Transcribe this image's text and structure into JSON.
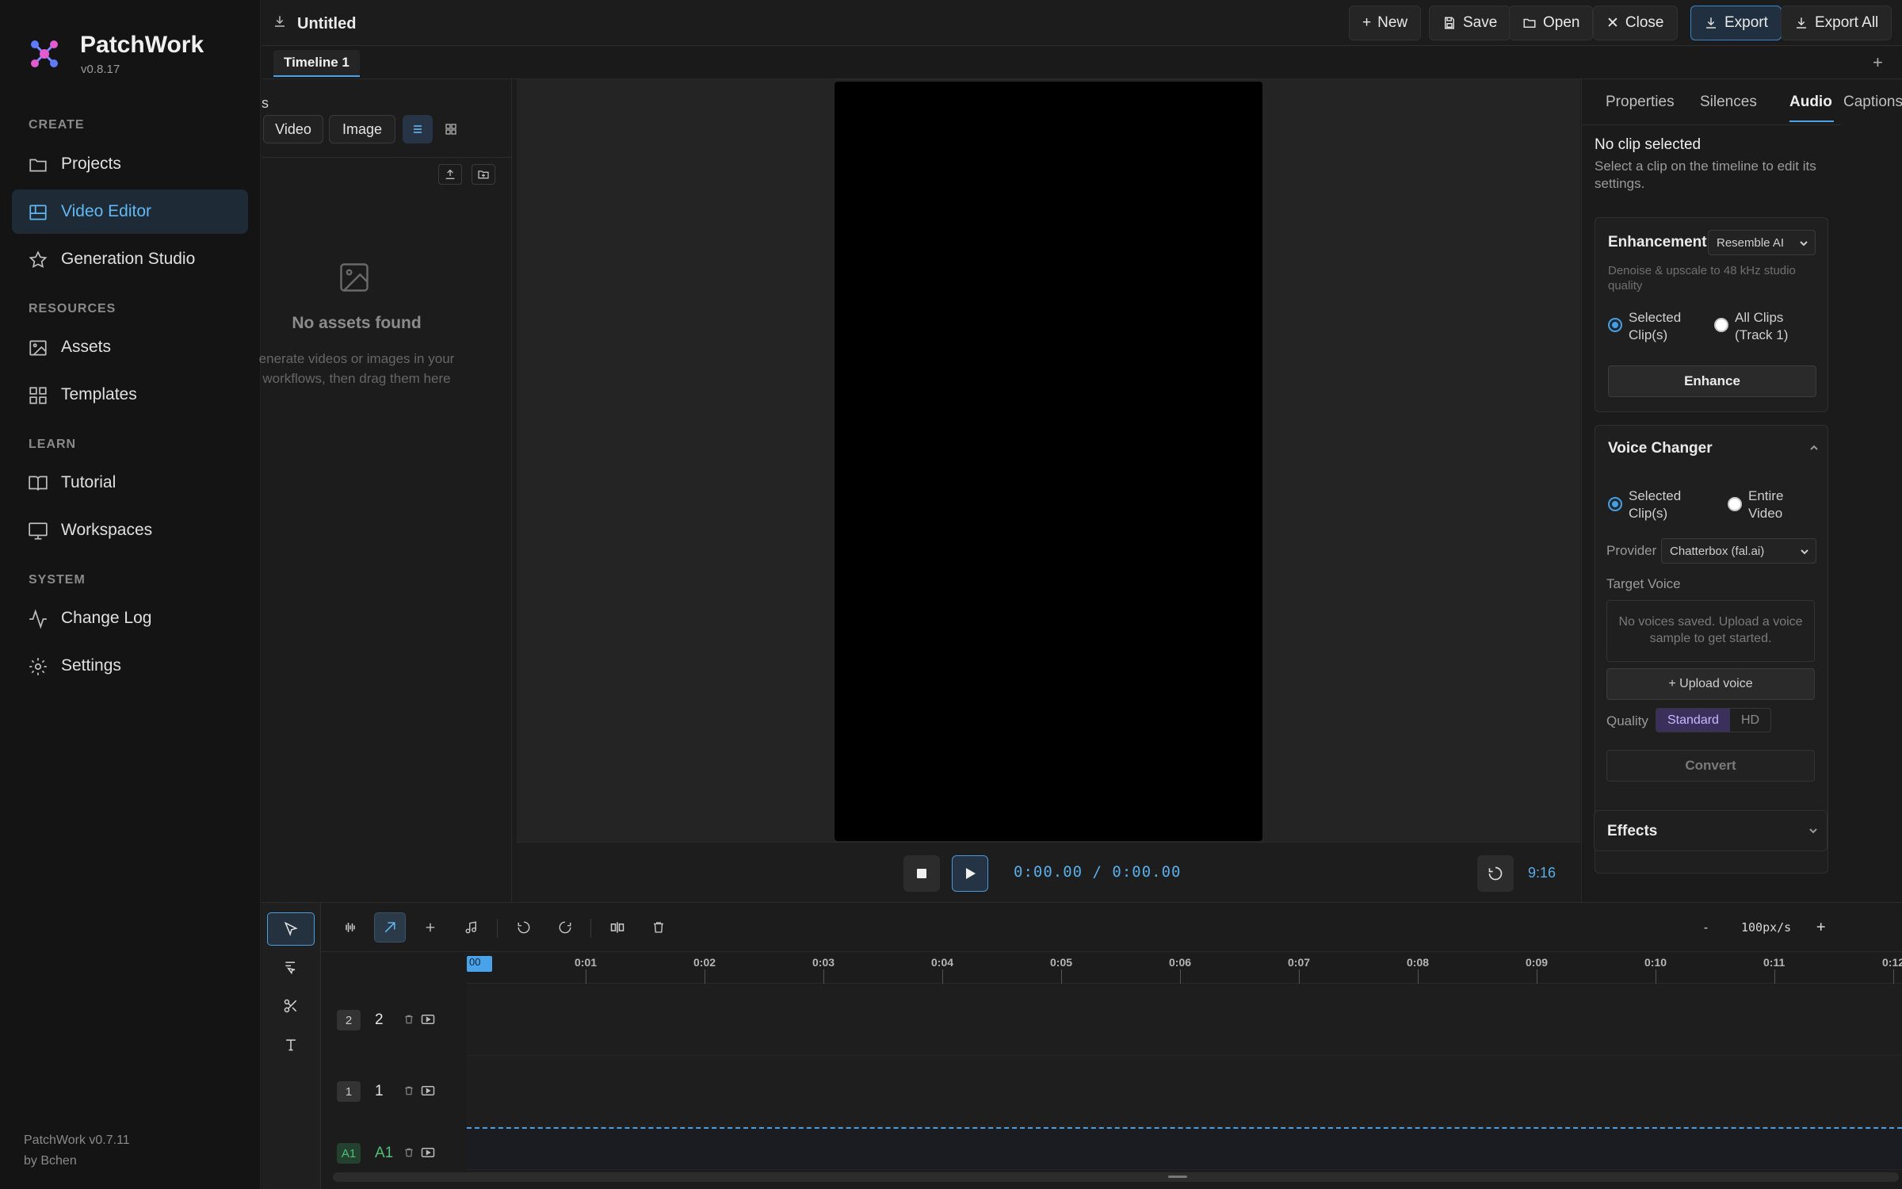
{
  "app": {
    "name": "PatchWork",
    "version": "v0.8.17"
  },
  "sidebar": {
    "sections": [
      {
        "title": "CREATE",
        "items": [
          {
            "label": "Projects",
            "icon": "folder-icon",
            "active": false
          },
          {
            "label": "Video Editor",
            "icon": "layout-icon",
            "active": true
          },
          {
            "label": "Generation Studio",
            "icon": "star-icon",
            "active": false
          }
        ]
      },
      {
        "title": "RESOURCES",
        "items": [
          {
            "label": "Assets",
            "icon": "image-icon",
            "active": false
          },
          {
            "label": "Templates",
            "icon": "grid-icon",
            "active": false
          }
        ]
      },
      {
        "title": "LEARN",
        "items": [
          {
            "label": "Tutorial",
            "icon": "book-icon",
            "active": false
          },
          {
            "label": "Workspaces",
            "icon": "monitor-icon",
            "active": false
          }
        ]
      },
      {
        "title": "SYSTEM",
        "items": [
          {
            "label": "Change Log",
            "icon": "activity-icon",
            "active": false
          },
          {
            "label": "Settings",
            "icon": "gear-icon",
            "active": false
          }
        ]
      }
    ],
    "footer": {
      "version": "PatchWork v0.7.11",
      "author": "by Bchen"
    }
  },
  "topbar": {
    "doc_title": "Untitled",
    "buttons": {
      "new": "New",
      "save": "Save",
      "open": "Open",
      "close": "Close",
      "export": "Export",
      "export_all": "Export All"
    }
  },
  "timeline_tabs": {
    "active": "Timeline 1",
    "add": "+"
  },
  "assets": {
    "heading_fragment": "s",
    "filters": {
      "video": "Video",
      "image": "Image"
    },
    "empty_title": "No assets found",
    "empty_desc": "enerate videos or images in your workflows, then drag them here"
  },
  "player": {
    "timecode": "0:00.00 / 0:00.00",
    "aspect_ratio": "9:16"
  },
  "right_panel": {
    "tabs": [
      "Properties",
      "Silences",
      "Audio",
      "Captions"
    ],
    "active_tab": "Audio",
    "no_clip_title": "No clip selected",
    "no_clip_desc": "Select a clip on the timeline to edit its settings.",
    "enhancement": {
      "title": "Enhancement",
      "provider": "Resemble AI",
      "hint": "Denoise & upscale to 48 kHz studio quality",
      "radio_selected": "Selected Clip(s)",
      "radio_all": "All Clips (Track 1)",
      "button": "Enhance"
    },
    "voice_changer": {
      "title": "Voice Changer",
      "radio_selected": "Selected Clip(s)",
      "radio_entire": "Entire Video",
      "provider_label": "Provider",
      "provider_value": "Chatterbox (fal.ai)",
      "target_label": "Target Voice",
      "no_voices": "No voices saved. Upload a voice sample to get started.",
      "upload_button": "+ Upload voice",
      "quality_label": "Quality",
      "quality_options": [
        "Standard",
        "HD"
      ],
      "quality_selected": "Standard",
      "convert_button": "Convert"
    },
    "effects": {
      "title": "Effects"
    }
  },
  "timeline": {
    "zoom": {
      "minus": "-",
      "value": "100px/s",
      "plus": "+"
    },
    "playhead_label": "00",
    "ruler_labels": [
      "0:01",
      "0:02",
      "0:03",
      "0:04",
      "0:05",
      "0:06",
      "0:07",
      "0:08",
      "0:09",
      "0:10",
      "0:11",
      "0:12"
    ],
    "tracks": [
      {
        "badge": "2",
        "name": "2"
      },
      {
        "badge": "1",
        "name": "1"
      },
      {
        "badge": "A1",
        "name": "A1"
      }
    ]
  },
  "colors": {
    "accent": "#4aa3e8",
    "active_nav": "#62b8f2",
    "quality_selected": "#3b2f5c"
  }
}
